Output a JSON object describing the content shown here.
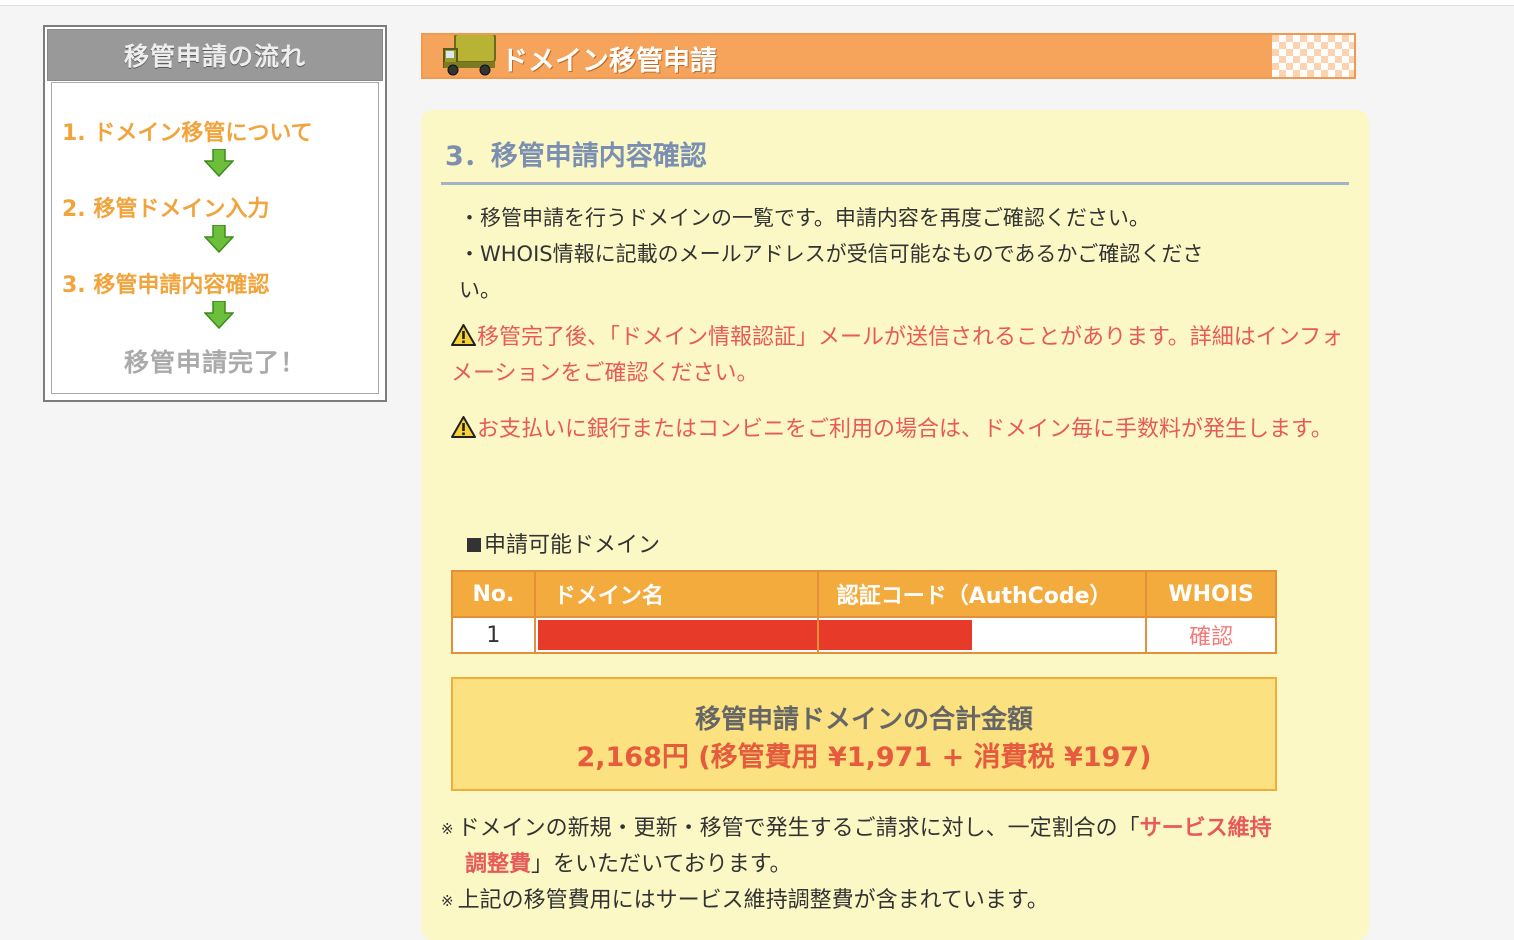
{
  "sidebar": {
    "title": "移管申請の流れ",
    "steps": [
      "1. ドメイン移管について",
      "2. 移管ドメイン入力",
      "3. 移管申請内容確認"
    ],
    "done": "移管申請完了！"
  },
  "header": {
    "title": "ドメイン移管申請"
  },
  "main": {
    "section_title": "3．移管申請内容確認",
    "notes": [
      "・移管申請を行うドメインの一覧です。申請内容を再度ご確認ください。",
      "・WHOIS情報に記載のメールアドレスが受信可能なものであるかご確認くださ",
      "い。"
    ],
    "warnings": [
      "移管完了後、「ドメイン情報認証」メールが送信されることがあります。詳細はインフォメーションをご確認ください。",
      "お支払いに銀行またはコンビニをご利用の場合は、ドメイン毎に手数料が発生します。"
    ],
    "available_label": "申請可能ドメイン",
    "table": {
      "headers": [
        "No.",
        "ドメイン名",
        "認証コード（AuthCode）",
        "WHOIS"
      ],
      "rows": [
        {
          "no": "1",
          "whois_link": "確認"
        }
      ]
    },
    "total": {
      "label": "移管申請ドメインの合計金額",
      "amount": "2,168円 (移管費用 ¥1,971 + 消費税 ¥197)"
    },
    "footnotes": {
      "mark": "※",
      "line1_pre": "ドメインの新規・更新・移管で発生するご請求に対し、一定割合の「",
      "line1_hl": "サービス維持",
      "line2_hl": "調整費",
      "line2_post": "」をいただいております。",
      "line3": "上記の移管費用にはサービス維持調整費が含まれています。"
    }
  },
  "colors": {
    "accent_orange": "#f6a35c",
    "table_header": "#f4ab3e",
    "panel_bg": "#fbf8c5",
    "warning_text": "#e85a5a",
    "redaction": "#e83a28"
  }
}
